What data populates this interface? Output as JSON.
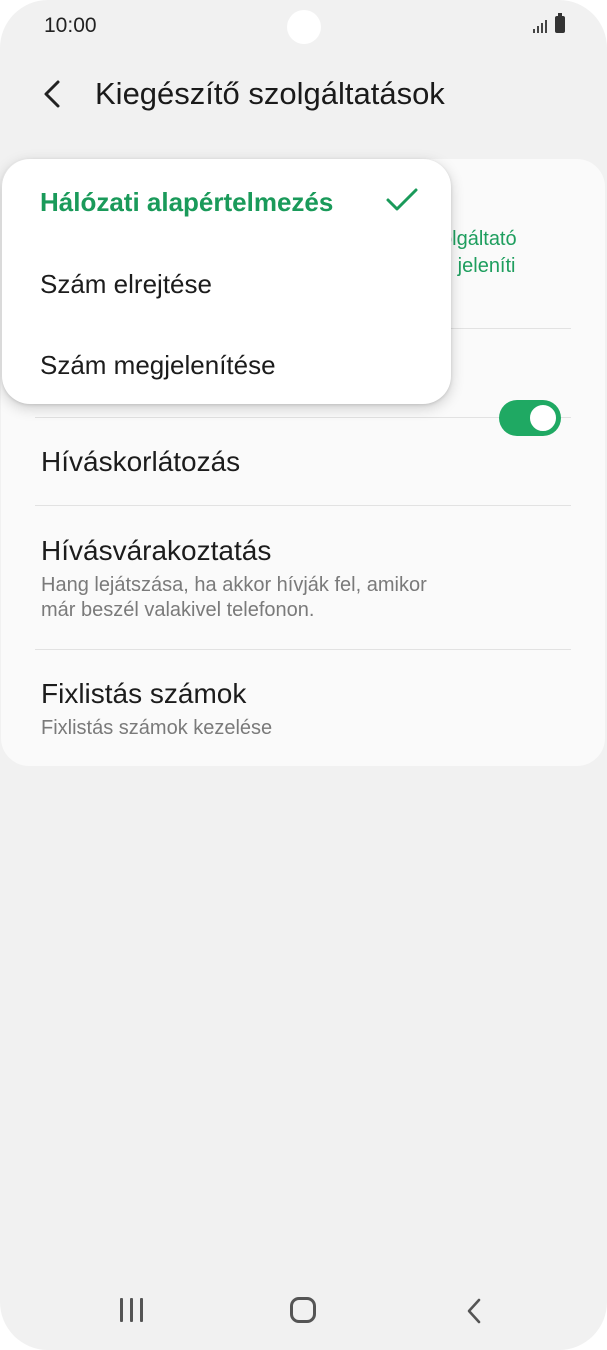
{
  "status_bar": {
    "time": "10:00"
  },
  "header": {
    "title": "Kiegészítő szolgáltatások"
  },
  "card": {
    "partial_text_line1": "olgáltató",
    "partial_text_line2": "n jeleníti",
    "items": [
      {
        "title": "Híváskorlátozás"
      },
      {
        "title": "Hívásvárakoztatás",
        "subtitle_line1": "Hang lejátszása, ha akkor hívják fel, amikor",
        "subtitle_line2": "már beszél valakivel telefonon.",
        "toggle_on": true
      },
      {
        "title": "Fixlistás számok",
        "subtitle": "Fixlistás számok kezelése"
      }
    ]
  },
  "dropdown": {
    "options": [
      {
        "label": "Hálózati alapértelmezés",
        "selected": true
      },
      {
        "label": "Szám elrejtése",
        "selected": false
      },
      {
        "label": "Szám megjelenítése",
        "selected": false
      }
    ]
  },
  "colors": {
    "accent": "#1fa963",
    "background": "#f1f1f1"
  },
  "icons": [
    "back-arrow-icon",
    "checkmark-icon",
    "signal-icon",
    "battery-icon",
    "recent-apps-icon",
    "home-icon",
    "nav-back-icon"
  ]
}
